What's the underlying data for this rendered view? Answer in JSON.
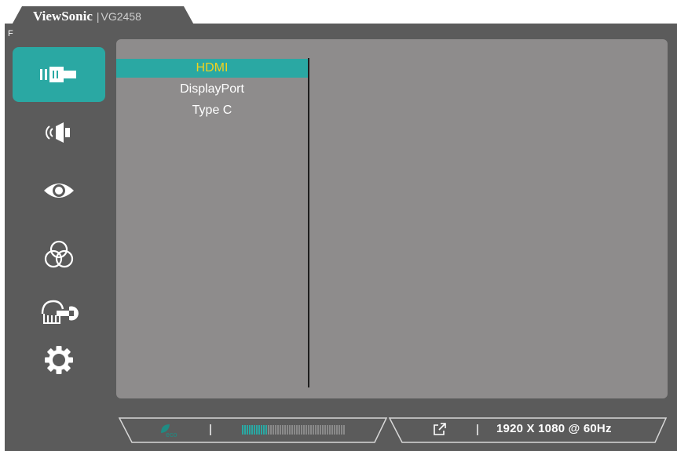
{
  "header": {
    "brand": "ViewSonic",
    "separator": "|",
    "model": "VG2458",
    "hotkey_label": "F"
  },
  "nav": {
    "items": [
      {
        "name": "input-select",
        "icon": "input-connector-icon",
        "active": true
      },
      {
        "name": "audio",
        "icon": "speaker-icon",
        "active": false
      },
      {
        "name": "view-mode",
        "icon": "eye-icon",
        "active": false
      },
      {
        "name": "color",
        "icon": "color-circles-icon",
        "active": false
      },
      {
        "name": "manual-adjust",
        "icon": "hand-wrench-icon",
        "active": false
      },
      {
        "name": "setup",
        "icon": "gear-icon",
        "active": false
      }
    ]
  },
  "submenu": {
    "items": [
      {
        "label": "HDMI",
        "selected": true
      },
      {
        "label": "DisplayPort",
        "selected": false
      },
      {
        "label": "Type C",
        "selected": false
      }
    ]
  },
  "status_bar": {
    "eco_icon": "eco-leaf-icon",
    "eco_level": 0.25,
    "osd_icon": "external-link-icon",
    "separator": "|",
    "resolution": "1920 X 1080 @ 60Hz"
  },
  "colors": {
    "accent": "#2aa8a3",
    "selected_text": "#f2d21d",
    "frame": "#5b5b5b",
    "panel": "#8e8c8c"
  }
}
